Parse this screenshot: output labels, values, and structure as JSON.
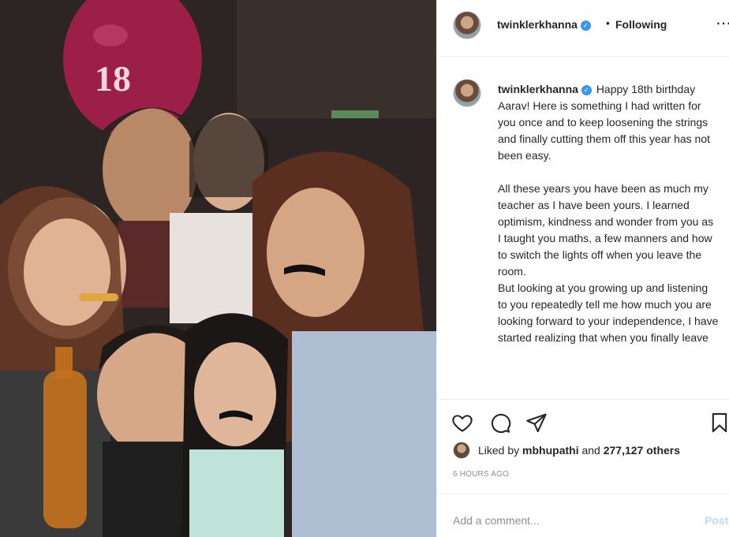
{
  "post": {
    "photo_alt": "Group birthday photo with balloon",
    "balloon_text": "18"
  },
  "header": {
    "username": "twinklerkhanna",
    "separator": "•",
    "follow_status": "Following",
    "more_icon": "more-horizontal-icon"
  },
  "caption": {
    "username": "twinklerkhanna",
    "text": "Happy 18th birthday Aarav! Here is something I had written for you once and to keep loosening the strings and finally cutting them off this year has not been easy.\n\nAll these years you have been as much my teacher as I have been yours. I learned optimism, kindness and wonder from you as I taught you maths, a few manners and how to switch the lights off when you leave the room.\nBut looking at you growing up and listening to you repeatedly tell me how much you are looking forward to your independence, I have started realizing that when you finally leave"
  },
  "actions": {
    "like_icon": "heart-icon",
    "comment_icon": "comment-icon",
    "share_icon": "send-icon",
    "save_icon": "bookmark-icon"
  },
  "likes": {
    "prefix": "Liked by ",
    "user": "mbhupathi",
    "middle": " and ",
    "count": "277,127 others"
  },
  "time_ago": "6 HOURS AGO",
  "comment_box": {
    "placeholder": "Add a comment...",
    "post_label": "Post"
  },
  "colors": {
    "verified": "#3897f0",
    "post_disabled": "#b2dffc",
    "balloon": "#9c1f4a"
  }
}
